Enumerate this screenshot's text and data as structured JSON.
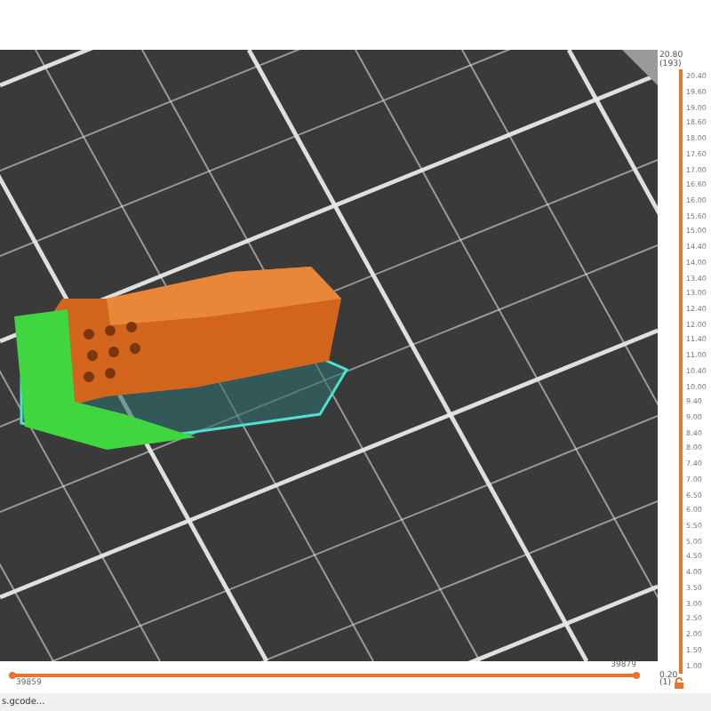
{
  "vertical_slider": {
    "top_value": "20.80",
    "top_layer": "(193)",
    "bottom_value": "0.20",
    "bottom_layer": "(1)",
    "ticks": [
      "20.40",
      "19.60",
      "19.00",
      "18.60",
      "18.00",
      "17.60",
      "17.00",
      "16.60",
      "16.00",
      "15.60",
      "15.00",
      "14.40",
      "14.00",
      "13.40",
      "13.00",
      "12.40",
      "12.00",
      "11.40",
      "11.00",
      "10.40",
      "10.00",
      "9.40",
      "9.00",
      "8.40",
      "8.00",
      "7.40",
      "7.00",
      "6.50",
      "6.00",
      "5.50",
      "5.00",
      "4.50",
      "4.00",
      "3.50",
      "3.00",
      "2.50",
      "2.00",
      "1.50",
      "1.00"
    ]
  },
  "horizontal_slider": {
    "right_value": "39879",
    "left_value": "39859"
  },
  "status_bar": {
    "text": "s.gcode..."
  }
}
